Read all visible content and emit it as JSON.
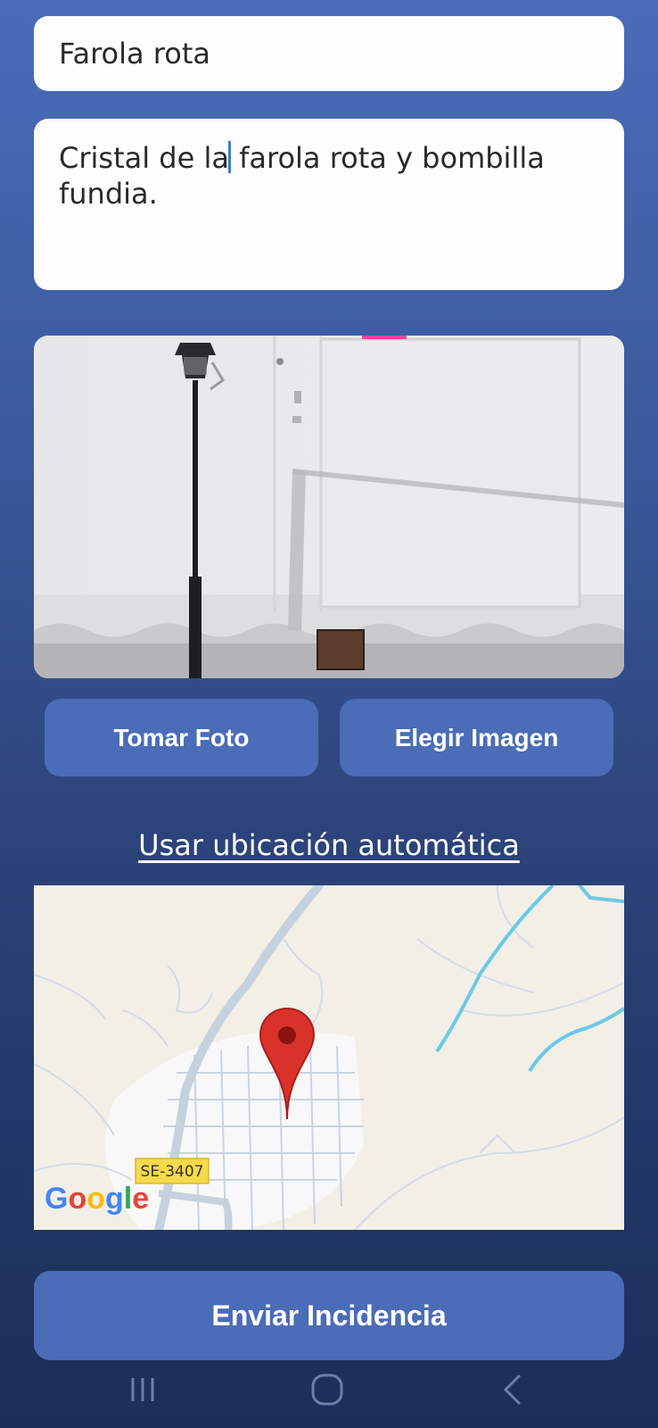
{
  "form": {
    "title_value": "Farola rota",
    "description_before_cursor": "Cristal de la",
    "description_after_cursor": " farola rota y bombilla fundia."
  },
  "photo": {
    "icon": "street-lamp-photo"
  },
  "buttons": {
    "take_photo": "Tomar Foto",
    "choose_image": "Elegir Imagen",
    "submit": "Enviar Incidencia"
  },
  "location": {
    "auto_link": "Usar ubicación automática"
  },
  "map": {
    "road_label": "SE-3407",
    "provider_logo": "Google",
    "marker_color": "#d9322a"
  },
  "nav": {
    "recents_icon": "recents-icon",
    "home_icon": "home-icon",
    "back_icon": "back-icon"
  },
  "colors": {
    "accent": "#4b6cb7",
    "background_top": "#4a6cb8",
    "background_bottom": "#1c2f58"
  }
}
